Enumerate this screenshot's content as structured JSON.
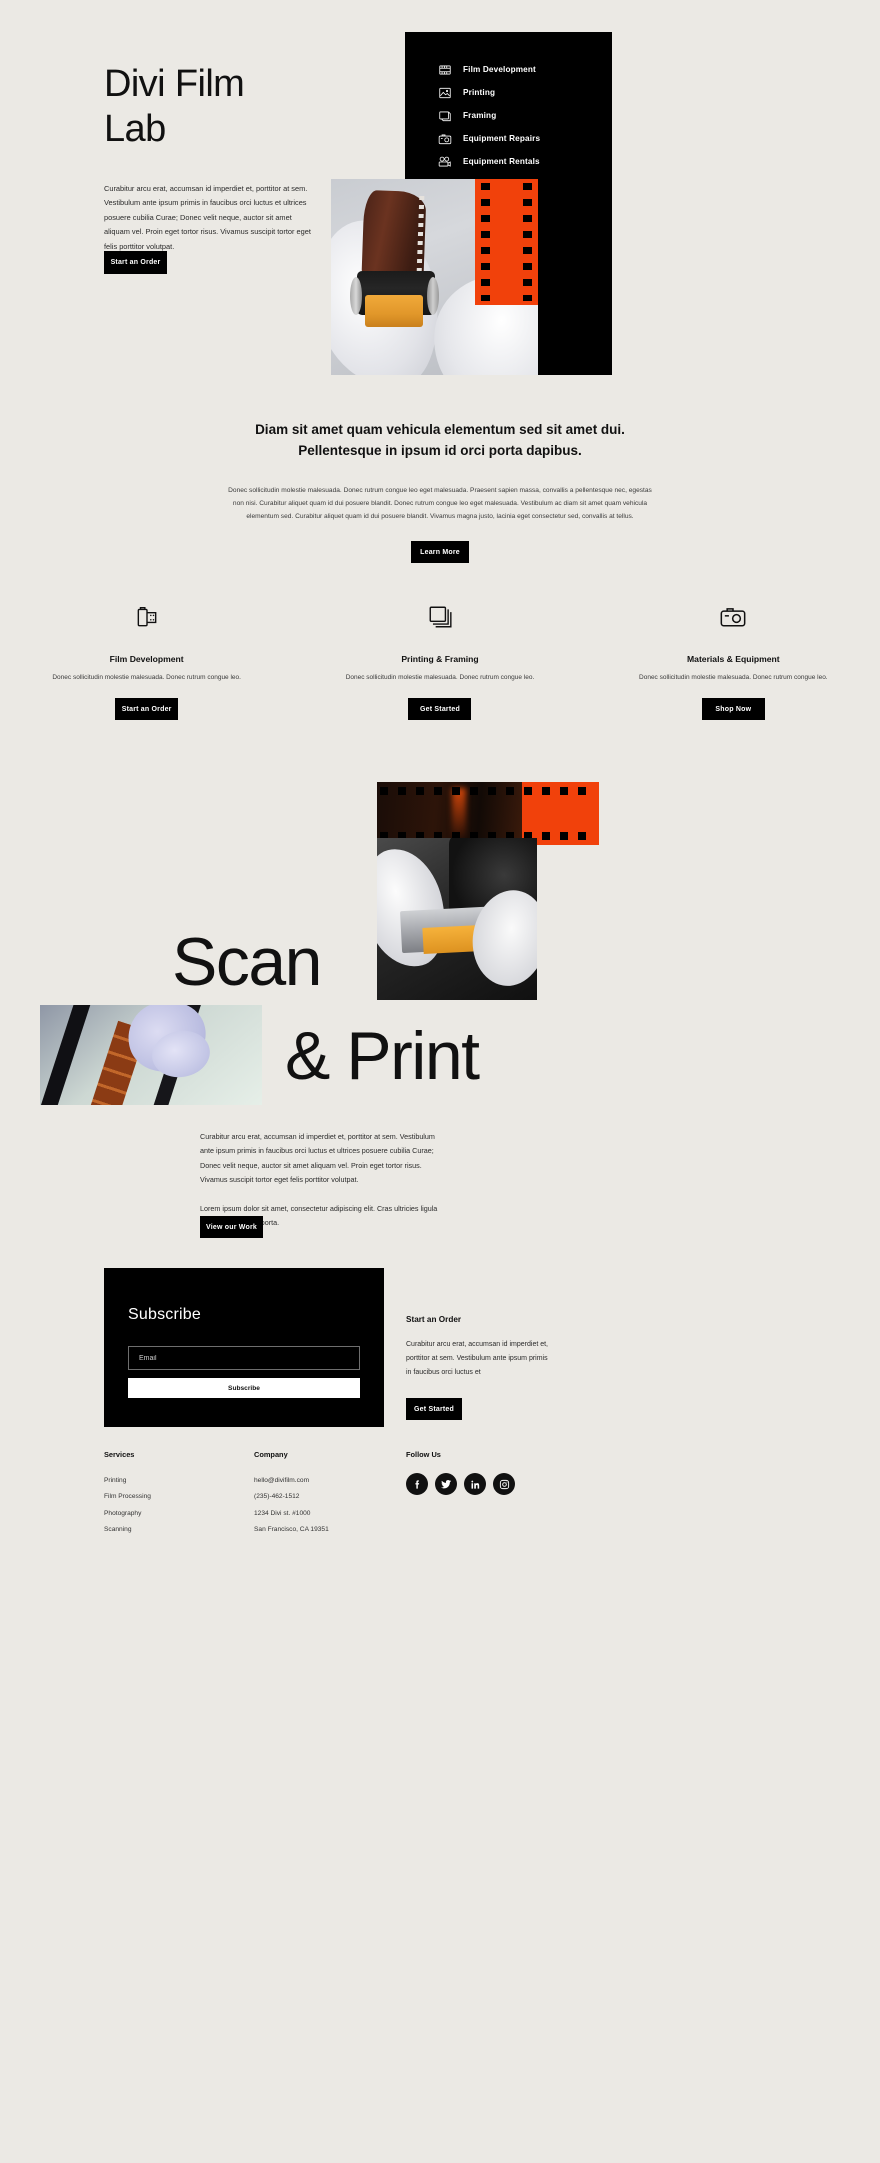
{
  "theme": {
    "bg": "#ebe9e4",
    "ink": "#111111",
    "accent_orange": "#f1410b",
    "black": "#000000",
    "white": "#ffffff"
  },
  "hero": {
    "title_line1": "Divi Film",
    "title_line2": "Lab",
    "paragraph": "Curabitur arcu erat, accumsan id imperdiet et, porttitor at sem. Vestibulum ante ipsum primis in faucibus orci luctus et ultrices posuere cubilia Curae; Donec velit neque, auctor sit amet aliquam vel. Proin eget tortor risus. Vivamus suscipit tortor eget felis porttitor volutpat.",
    "cta_label": "Start an Order",
    "nav": [
      {
        "label": "Film Development",
        "icon": "film-strip-icon"
      },
      {
        "label": "Printing",
        "icon": "image-icon"
      },
      {
        "label": "Framing",
        "icon": "frame-icon"
      },
      {
        "label": "Equipment Repairs",
        "icon": "camera-icon"
      },
      {
        "label": "Equipment Rentals",
        "icon": "movie-camera-icon"
      }
    ]
  },
  "intro": {
    "heading": "Diam sit amet quam vehicula elementum sed sit amet dui. Pellentesque in ipsum id orci porta dapibus.",
    "paragraph": "Donec sollicitudin molestie malesuada. Donec rutrum congue leo eget malesuada. Praesent sapien massa, convallis a pellentesque nec, egestas non nisi. Curabitur aliquet quam id dui posuere blandit. Donec rutrum congue leo eget malesuada. Vestibulum ac diam sit amet quam vehicula elementum sed. Curabitur aliquet quam id dui posuere blandit. Vivamus magna justo, lacinia eget consectetur sed, convallis at tellus.",
    "cta_label": "Learn More"
  },
  "services": [
    {
      "icon": "film-canister-icon",
      "title": "Film Development",
      "body": "Donec sollicitudin molestie malesuada. Donec rutrum congue leo.",
      "cta_label": "Start an Order"
    },
    {
      "icon": "stacked-papers-icon",
      "title": "Printing & Framing",
      "body": "Donec sollicitudin molestie malesuada. Donec rutrum congue leo.",
      "cta_label": "Get Started"
    },
    {
      "icon": "camera-icon",
      "title": "Materials & Equipment",
      "body": "Donec sollicitudin molestie malesuada. Donec rutrum congue leo.",
      "cta_label": "Shop Now"
    }
  ],
  "scan": {
    "word1": "Scan",
    "word2": "& Print",
    "paragraph1": "Curabitur arcu erat, accumsan id imperdiet et, porttitor at sem. Vestibulum ante ipsum primis in faucibus orci luctus et ultrices posuere cubilia Curae; Donec velit neque, auctor sit amet aliquam vel. Proin eget tortor risus. Vivamus suscipit tortor eget felis porttitor volutpat.",
    "paragraph2": "Lorem ipsum dolor sit amet, consectetur adipiscing elit. Cras ultricies ligula sed magna dictum porta.",
    "cta_label": "View our Work"
  },
  "subscribe": {
    "heading": "Subscribe",
    "email_placeholder": "Email",
    "email_value": "",
    "button_label": "Subscribe"
  },
  "order": {
    "heading": "Start an Order",
    "paragraph": "Curabitur arcu erat, accumsan id imperdiet et, porttitor at sem. Vestibulum ante ipsum primis in faucibus orci luctus et",
    "cta_label": "Get Started"
  },
  "footer": {
    "services": {
      "heading": "Services",
      "items": [
        "Printing",
        "Film Processing",
        "Photography",
        "Scanning"
      ]
    },
    "company": {
      "heading": "Company",
      "items": [
        "hello@divifilm.com",
        "(235)-462-1512",
        "1234 Divi st. #1000",
        "San Francisco, CA 19351"
      ]
    },
    "follow": {
      "heading": "Follow Us",
      "socials": [
        {
          "name": "facebook-icon",
          "glyph": "f"
        },
        {
          "name": "twitter-icon",
          "glyph": "t"
        },
        {
          "name": "linkedin-icon",
          "glyph": "in"
        },
        {
          "name": "instagram-icon",
          "glyph": "ig"
        }
      ]
    }
  }
}
